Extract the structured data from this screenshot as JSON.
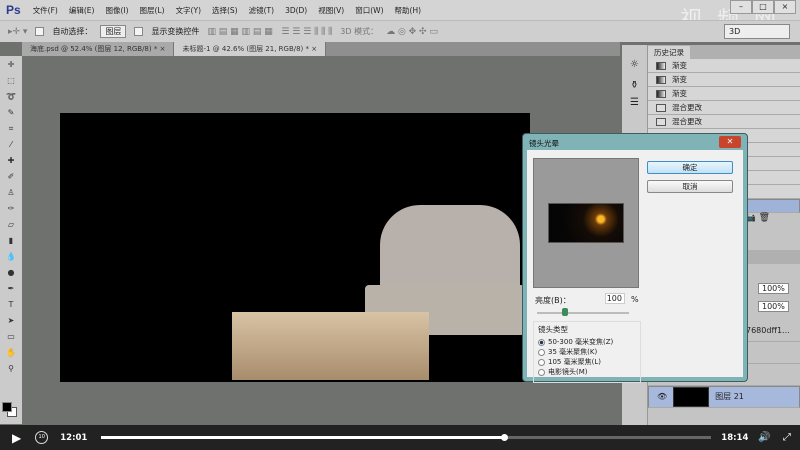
{
  "app": {
    "logo": "Ps",
    "watermark": "视 频 网"
  },
  "menu": [
    "文件(F)",
    "编辑(E)",
    "图像(I)",
    "图层(L)",
    "文字(Y)",
    "选择(S)",
    "滤镜(T)",
    "3D(D)",
    "视图(V)",
    "窗口(W)",
    "帮助(H)"
  ],
  "window_controls": {
    "minimize": "–",
    "maximize": "□",
    "close": "×"
  },
  "options": {
    "auto_select_label": "自动选择：",
    "auto_select_value": "图层",
    "show_transform_label": "显示变换控件",
    "mode_3d_label": "3D 模式：",
    "workspace": "3D"
  },
  "tabs": [
    {
      "label": "海底.psd @ 52.4% (图层 12, RGB/8) *",
      "close": "×"
    },
    {
      "label": "未标题-1 @ 42.6% (图层 21, RGB/8) *",
      "close": "×"
    }
  ],
  "history": {
    "title": "历史记录",
    "items": [
      "渐变",
      "渐变",
      "渐变",
      "混合更改",
      "混合更改"
    ]
  },
  "layers": {
    "opacity": "100%",
    "fill": "100%",
    "layer_name_partial": "7680dff1...",
    "selected_layer": "图层 21"
  },
  "dialog": {
    "title": "镜头光晕",
    "ok": "确定",
    "cancel": "取消",
    "brightness_label": "亮度(B)：",
    "brightness_value": "100",
    "brightness_unit": "%",
    "brightness_fraction": 0.3,
    "lens_type_label": "镜头类型",
    "lens_types": [
      "50-300 毫米变焦(Z)",
      "35 毫米聚焦(K)",
      "105 毫米聚焦(L)",
      "电影镜头(M)"
    ],
    "selected_lens": 0
  },
  "player": {
    "current_time": "12:01",
    "total_time": "18:14",
    "progress": 0.66
  }
}
